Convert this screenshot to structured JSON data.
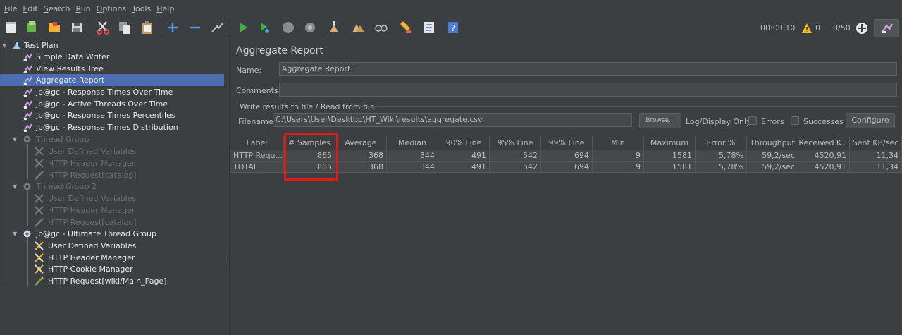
{
  "menu": [
    {
      "label": "File",
      "mnemonic": "F"
    },
    {
      "label": "Edit",
      "mnemonic": "E"
    },
    {
      "label": "Search",
      "mnemonic": "S"
    },
    {
      "label": "Run",
      "mnemonic": "R"
    },
    {
      "label": "Options",
      "mnemonic": "O"
    },
    {
      "label": "Tools",
      "mnemonic": "T"
    },
    {
      "label": "Help",
      "mnemonic": "H"
    }
  ],
  "toolbar": {
    "timer": "00:00:10",
    "warnings": "0",
    "threads": "0/50",
    "icons": [
      "new-icon",
      "templates-icon",
      "open-icon",
      "save-icon",
      "cut-icon",
      "copy-icon",
      "paste-icon",
      "expand-icon",
      "collapse-icon",
      "toggle-icon",
      "start-icon",
      "start-no-pause-icon",
      "stop-icon",
      "shutdown-icon",
      "clear-icon",
      "clear-all-icon",
      "search-icon",
      "reset-search-icon",
      "function-helper-icon",
      "help-icon"
    ]
  },
  "tree": {
    "test_plan": "Test Plan",
    "items": [
      {
        "label": "Simple Data Writer",
        "icon": "listener-icon",
        "state": "normal"
      },
      {
        "label": "View Results Tree",
        "icon": "listener-icon",
        "state": "normal"
      },
      {
        "label": "Aggregate Report",
        "icon": "listener-icon",
        "state": "selected"
      },
      {
        "label": "jp@gc - Response Times Over Time",
        "icon": "listener-icon",
        "state": "normal"
      },
      {
        "label": "jp@gc - Active Threads Over Time",
        "icon": "listener-icon",
        "state": "normal"
      },
      {
        "label": "jp@gc - Response Times Percentiles",
        "icon": "listener-icon",
        "state": "normal"
      },
      {
        "label": "jp@gc - Response Times Distribution",
        "icon": "listener-icon",
        "state": "normal"
      }
    ],
    "groups": [
      {
        "label": "Thread Group",
        "state": "dim",
        "children": [
          "User Defined Variables",
          "HTTP Header Manager",
          "HTTP Request[catalog]"
        ]
      },
      {
        "label": "Thread Group 2",
        "state": "dim",
        "children": [
          "User Defined Variables",
          "HTTP Header Manager",
          "HTTP Request[catalog]"
        ]
      },
      {
        "label": "jp@gc - Ultimate Thread Group",
        "state": "bright",
        "children": [
          "User Defined Variables",
          "HTTP Header Manager",
          "HTTP Cookie Manager",
          "HTTP Request[wiki/Main_Page]"
        ]
      }
    ]
  },
  "panel": {
    "title": "Aggregate Report",
    "name_label": "Name:",
    "name_value": "Aggregate Report",
    "comments_label": "Comments:",
    "comments_value": "",
    "write_group_label": "Write results to file / Read from file",
    "filename_label": "Filename",
    "filename_value": "C:\\Users\\User\\Desktop\\HT_Wiki\\results\\aggregate.csv",
    "browse_label": "Browse...",
    "log_display_label": "Log/Display Only:",
    "errors_label": "Errors",
    "successes_label": "Successes",
    "configure_label": "Configure"
  },
  "table": {
    "columns": [
      "Label",
      "# Samples",
      "Average",
      "Median",
      "90% Line",
      "95% Line",
      "99% Line",
      "Min",
      "Maximum",
      "Error %",
      "Throughput",
      "Received K...",
      "Sent KB/sec"
    ],
    "rows": [
      [
        "HTTP Requ...",
        "865",
        "368",
        "344",
        "491",
        "542",
        "694",
        "9",
        "1581",
        "5,78%",
        "59,2/sec",
        "4520,91",
        "11,34"
      ],
      [
        "TOTAL",
        "865",
        "368",
        "344",
        "491",
        "542",
        "694",
        "9",
        "1581",
        "5,78%",
        "59,2/sec",
        "4520,91",
        "11,34"
      ]
    ]
  },
  "colors": {
    "background": "#3c3f41",
    "selection": "#4b6eaf",
    "highlight_box": "#e0191b",
    "listener_icon": "#c8a0e0"
  }
}
